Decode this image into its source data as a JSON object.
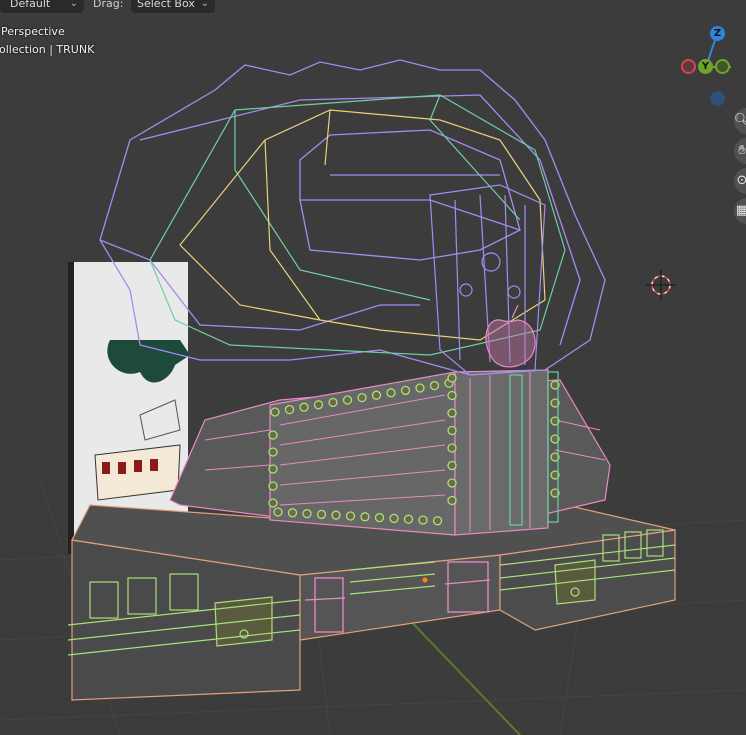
{
  "header": {
    "orientation_value": "Default",
    "drag_label": "Drag:",
    "drag_value": "Select Box"
  },
  "overlay": {
    "view_name": "Perspective",
    "collection_text": "ollection | TRUNK"
  },
  "gizmo": {
    "z_label": "Z",
    "y_label": "Y",
    "z_color": "#2f84e0",
    "y_color": "#6ea62a",
    "x_color": "#d6454e"
  },
  "nav_tools": [
    {
      "name": "zoom-icon",
      "glyph": "🔍"
    },
    {
      "name": "pan-hand-icon",
      "glyph": "✋"
    },
    {
      "name": "camera-icon",
      "glyph": "🎥"
    },
    {
      "name": "grid-ortho-icon",
      "glyph": "▦"
    }
  ],
  "scene_colors": {
    "wire_purple": "#a38cf0",
    "wire_teal": "#6fd0a0",
    "wire_yellow": "#e8d27a",
    "wire_pink": "#e98ac5",
    "wire_salmon": "#e2a07a",
    "wire_green": "#a8e07a"
  }
}
